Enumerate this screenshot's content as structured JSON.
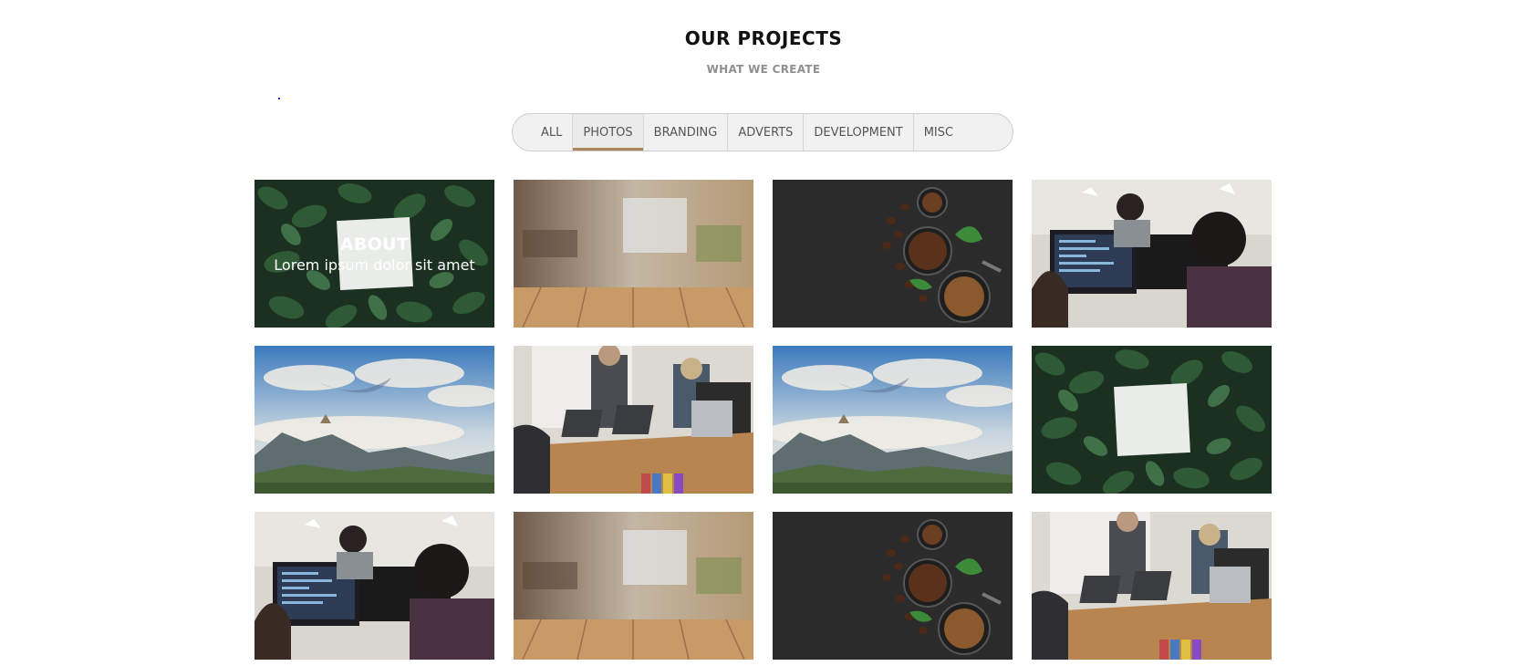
{
  "header": {
    "title": "OUR PROJECTS",
    "subtitle": "WHAT WE CREATE"
  },
  "filters": {
    "tabs": [
      {
        "label": "ALL"
      },
      {
        "label": "PHOTOS"
      },
      {
        "label": "BRANDING"
      },
      {
        "label": "ADVERTS"
      },
      {
        "label": "DEVELOPMENT"
      },
      {
        "label": "MISC"
      }
    ],
    "active": "PHOTOS",
    "accent_color": "#a98860"
  },
  "gallery": {
    "items": [
      {
        "scene": "leaves-card",
        "overlay_title": "ABOUT",
        "overlay_text": "Lorem ipsum dolor sit amet"
      },
      {
        "scene": "cafe-table"
      },
      {
        "scene": "coffee-beans"
      },
      {
        "scene": "office-laptop"
      },
      {
        "scene": "mountain-clouds"
      },
      {
        "scene": "meeting-room"
      },
      {
        "scene": "mountain-clouds"
      },
      {
        "scene": "leaves-card"
      },
      {
        "scene": "office-laptop"
      },
      {
        "scene": "cafe-table"
      },
      {
        "scene": "coffee-beans"
      },
      {
        "scene": "meeting-room"
      }
    ]
  }
}
